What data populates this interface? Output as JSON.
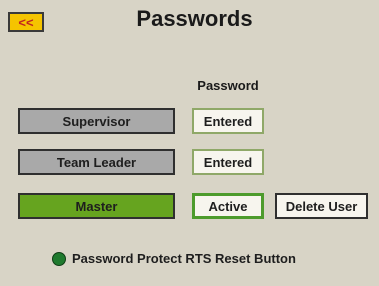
{
  "header": {
    "back_label": "<<",
    "title": "Passwords"
  },
  "table": {
    "column_header": "Password"
  },
  "users": [
    {
      "label": "Supervisor",
      "status": "Entered",
      "active": false
    },
    {
      "label": "Team Leader",
      "status": "Entered",
      "active": false
    },
    {
      "label": "Master",
      "status": "Active",
      "active": true
    }
  ],
  "actions": {
    "delete_label": "Delete User"
  },
  "protect": {
    "label": "Password Protect RTS Reset Button",
    "indicator": "on"
  },
  "colors": {
    "background": "#d8d4c6",
    "back_button": "#f5c400",
    "user_button": "#a9a9a9",
    "active_user_button": "#66a41f",
    "indicator_on": "#1f7a2e"
  }
}
